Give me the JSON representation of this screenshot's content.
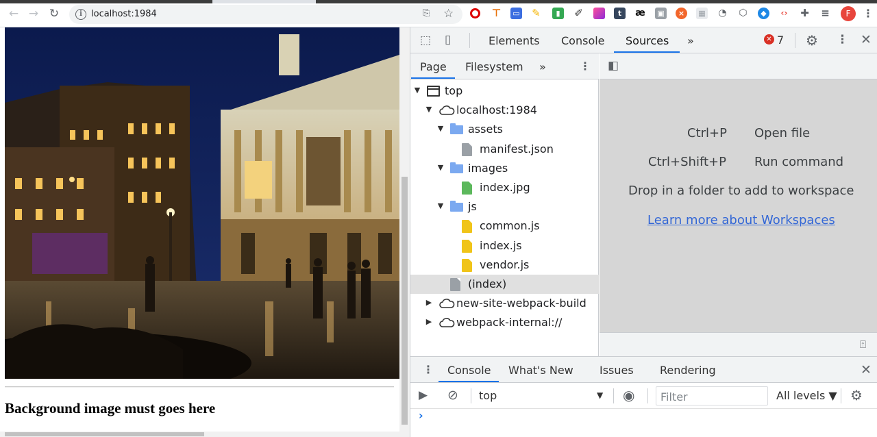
{
  "browser": {
    "url": "localhost:1984",
    "profile_initial": "F",
    "extension_icons": [
      "opera-icon",
      "key-icon",
      "screen-icon",
      "pen-icon",
      "book-icon",
      "eyedropper-icon",
      "gradient-icon",
      "tumblr-icon",
      "ae-icon",
      "save-icon",
      "close-circle-icon",
      "grid-icon",
      "snail-icon",
      "cube-icon",
      "shield-icon",
      "code-icon",
      "puzzle-icon",
      "playlist-icon"
    ]
  },
  "webpage": {
    "heading": "Background image must goes here"
  },
  "devtools": {
    "tabs": [
      "Elements",
      "Console",
      "Sources"
    ],
    "active_tab": "Sources",
    "more_tabs": "»",
    "error_count": "7",
    "navigator": {
      "tabs": [
        "Page",
        "Filesystem"
      ],
      "more": "»",
      "tree": [
        {
          "label": "top",
          "type": "frame",
          "expanded": true
        },
        {
          "label": "localhost:1984",
          "type": "cloud",
          "expanded": true
        },
        {
          "label": "assets",
          "type": "folder",
          "expanded": true
        },
        {
          "label": "manifest.json",
          "type": "file-gray"
        },
        {
          "label": "images",
          "type": "folder",
          "expanded": true
        },
        {
          "label": "index.jpg",
          "type": "file-green"
        },
        {
          "label": "js",
          "type": "folder",
          "expanded": true
        },
        {
          "label": "common.js",
          "type": "file-yellow"
        },
        {
          "label": "index.js",
          "type": "file-yellow"
        },
        {
          "label": "vendor.js",
          "type": "file-yellow"
        },
        {
          "label": "(index)",
          "type": "file-gray",
          "selected": true
        },
        {
          "label": "new-site-webpack-build",
          "type": "cloud",
          "expanded": false
        },
        {
          "label": "webpack-internal://",
          "type": "cloud",
          "expanded": false
        }
      ]
    },
    "editor": {
      "shortcut1_key": "Ctrl+P",
      "shortcut1_action": "Open file",
      "shortcut2_key": "Ctrl+Shift+P",
      "shortcut2_action": "Run command",
      "drop_hint": "Drop in a folder to add to workspace",
      "learn_link": "Learn more about Workspaces"
    },
    "drawer": {
      "tabs": [
        "Console",
        "What's New",
        "Issues",
        "Rendering"
      ],
      "active_tab": "Console",
      "context": "top",
      "filter_placeholder": "Filter",
      "levels": "All levels ▼",
      "prompt": "›"
    }
  },
  "colors": {
    "accent": "#1a73e8",
    "error": "#d93025",
    "folder": "#7ba9f0",
    "js_file": "#f0c419",
    "image_file": "#5cb85c"
  }
}
